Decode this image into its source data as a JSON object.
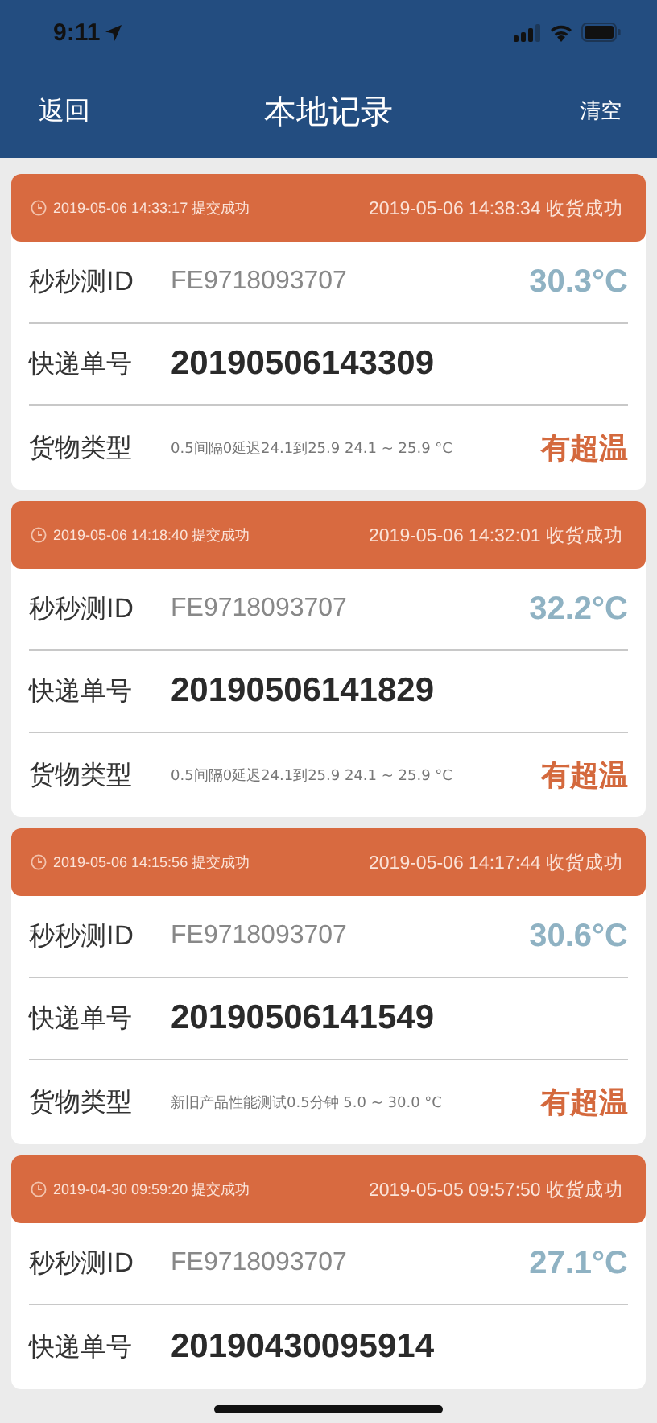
{
  "status_bar": {
    "time": "9:11"
  },
  "nav": {
    "back": "返回",
    "title": "本地记录",
    "action": "清空"
  },
  "records": [
    {
      "submitted": "2019-05-06 14:33:17 提交成功",
      "received": "2019-05-06 14:38:34 收货成功",
      "rows": [
        {
          "kind": "id",
          "label": "秒秒测ID",
          "value": "FE9718093707",
          "temp": "30.3°C"
        },
        {
          "kind": "tracking",
          "label": "快递单号",
          "value": "20190506143309"
        },
        {
          "kind": "cargo",
          "label": "货物类型",
          "value": "0.5间隔0延迟24.1到25.9 24.1 ~ 25.9 °C",
          "alert": "有超温"
        }
      ]
    },
    {
      "submitted": "2019-05-06 14:18:40 提交成功",
      "received": "2019-05-06 14:32:01 收货成功",
      "rows": [
        {
          "kind": "id",
          "label": "秒秒测ID",
          "value": "FE9718093707",
          "temp": "32.2°C"
        },
        {
          "kind": "tracking",
          "label": "快递单号",
          "value": "20190506141829"
        },
        {
          "kind": "cargo",
          "label": "货物类型",
          "value": "0.5间隔0延迟24.1到25.9 24.1 ~ 25.9 °C",
          "alert": "有超温"
        }
      ]
    },
    {
      "submitted": "2019-05-06 14:15:56 提交成功",
      "received": "2019-05-06 14:17:44 收货成功",
      "rows": [
        {
          "kind": "id",
          "label": "秒秒测ID",
          "value": "FE9718093707",
          "temp": "30.6°C"
        },
        {
          "kind": "tracking",
          "label": "快递单号",
          "value": "20190506141549"
        },
        {
          "kind": "cargo",
          "label": "货物类型",
          "value": "新旧产品性能测试0.5分钟 5.0 ~ 30.0 °C",
          "alert": "有超温"
        }
      ]
    },
    {
      "submitted": "2019-04-30 09:59:20 提交成功",
      "received": "2019-05-05 09:57:50 收货成功",
      "rows": [
        {
          "kind": "id",
          "label": "秒秒测ID",
          "value": "FE9718093707",
          "temp": "27.1°C"
        },
        {
          "kind": "tracking",
          "label": "快递单号",
          "value": "20190430095914"
        }
      ]
    }
  ]
}
